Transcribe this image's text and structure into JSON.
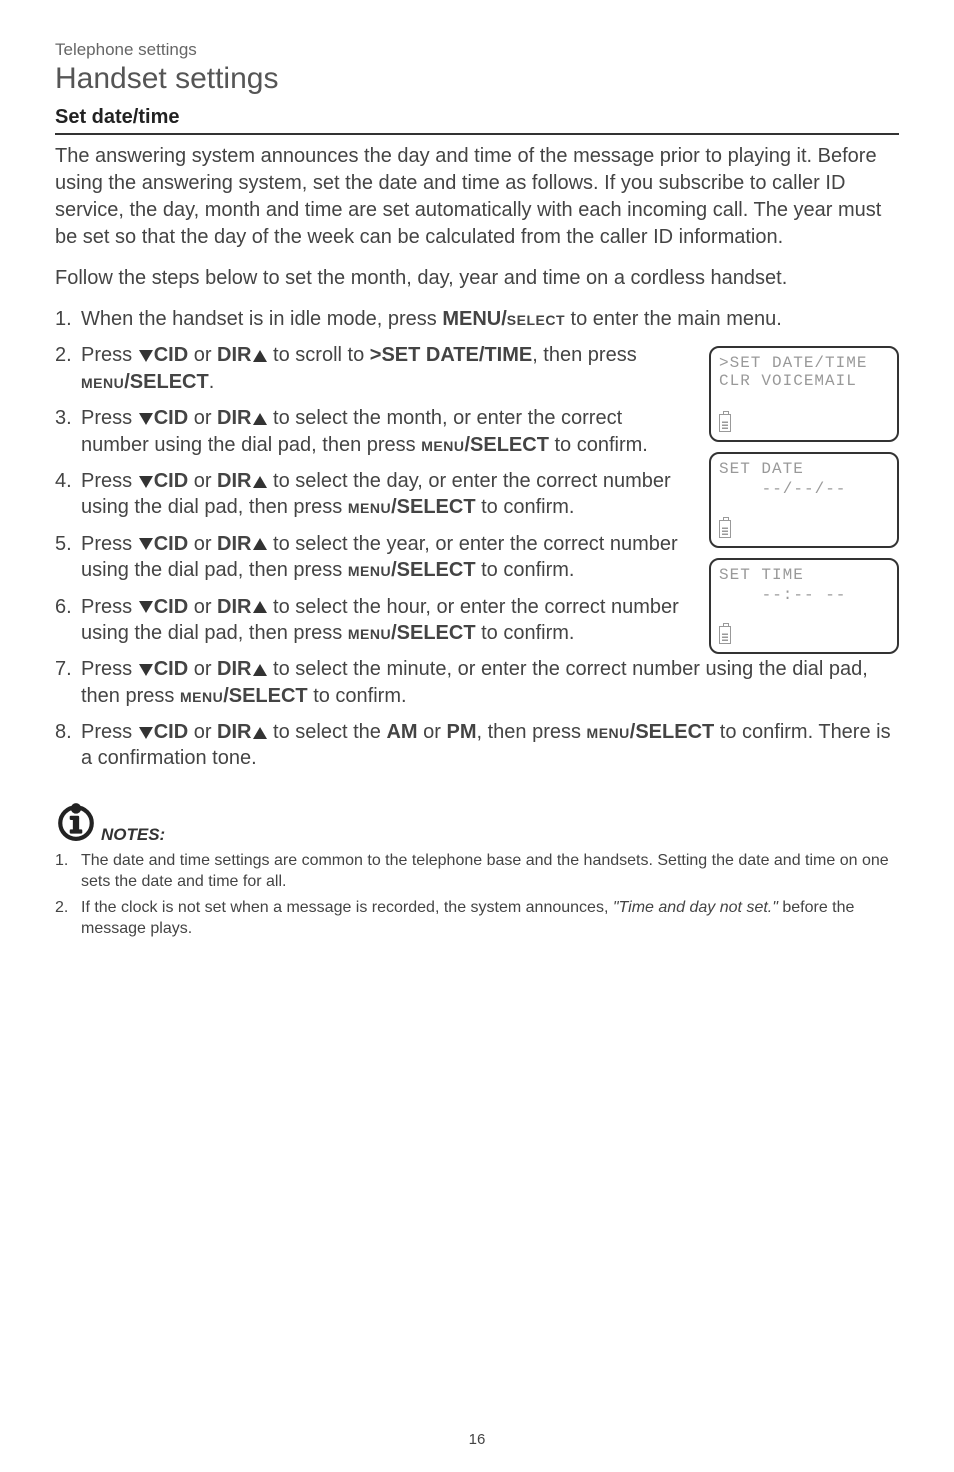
{
  "breadcrumb": "Telephone settings",
  "page_title": "Handset settings",
  "section_title": "Set date/time",
  "intro1": "The answering system announces the day and time of the message prior to playing it. Before using the answering system, set the date and time as follows. If you subscribe to caller ID service, the day, month and time are set automatically with each incoming call. The year must be set so that the day of the week can be calculated from the caller ID information.",
  "intro2": "Follow the steps below to set the month, day, year and time on a cordless handset.",
  "steps": {
    "s1a": "When the handset is in idle mode, press ",
    "s1b": "MENU/",
    "s1c": "select",
    "s1d": " to enter the main menu.",
    "s2a": "Press ",
    "s2b": "CID",
    "s2c": " or ",
    "s2d": "DIR",
    "s2e": " to scroll to ",
    "s2f": ">SET DATE/TIME",
    "s2g": ", then press ",
    "s2h": "menu",
    "s2i": "/SELECT",
    "s2j": ".",
    "s3a": "Press ",
    "s3e": " to select the month, or enter the correct number using the dial pad, then press ",
    "s3j": " to confirm.",
    "s4e": " to select the day, or enter the correct number using the dial pad, then press ",
    "s4j": " to confirm.",
    "s5e": " to select the year, or enter the correct number using the dial pad, then press ",
    "s5j": " to confirm.",
    "s6e": " to select the hour, or enter the correct number using the dial pad, then press ",
    "s6j": " to confirm.",
    "s7e": " to select the minute, or enter the correct number using the dial pad, then press ",
    "s7j": " to confirm.",
    "s8e": " to select the ",
    "s8f": "AM",
    "s8g": " or ",
    "s8h": "PM",
    "s8i": ", then press ",
    "s8j": " to confirm. There is a confirmation tone."
  },
  "screens": {
    "sc1a": ">SET DATE/TIME",
    "sc1b": " CLR VOICEMAIL",
    "sc2a": "SET DATE",
    "sc2b": "--/--/--",
    "sc3a": "SET TIME",
    "sc3b": "--:-- --"
  },
  "notes_label": "NOTES:",
  "notes": {
    "n1": "The date and time settings are common to the telephone base and the handsets. Setting the date and time on one sets the date and time for all.",
    "n2a": "If the clock is not set when a message is recorded, the system announces, ",
    "n2b": "\"Time and day not set.\"",
    "n2c": " before the message plays."
  },
  "page_number": "16"
}
